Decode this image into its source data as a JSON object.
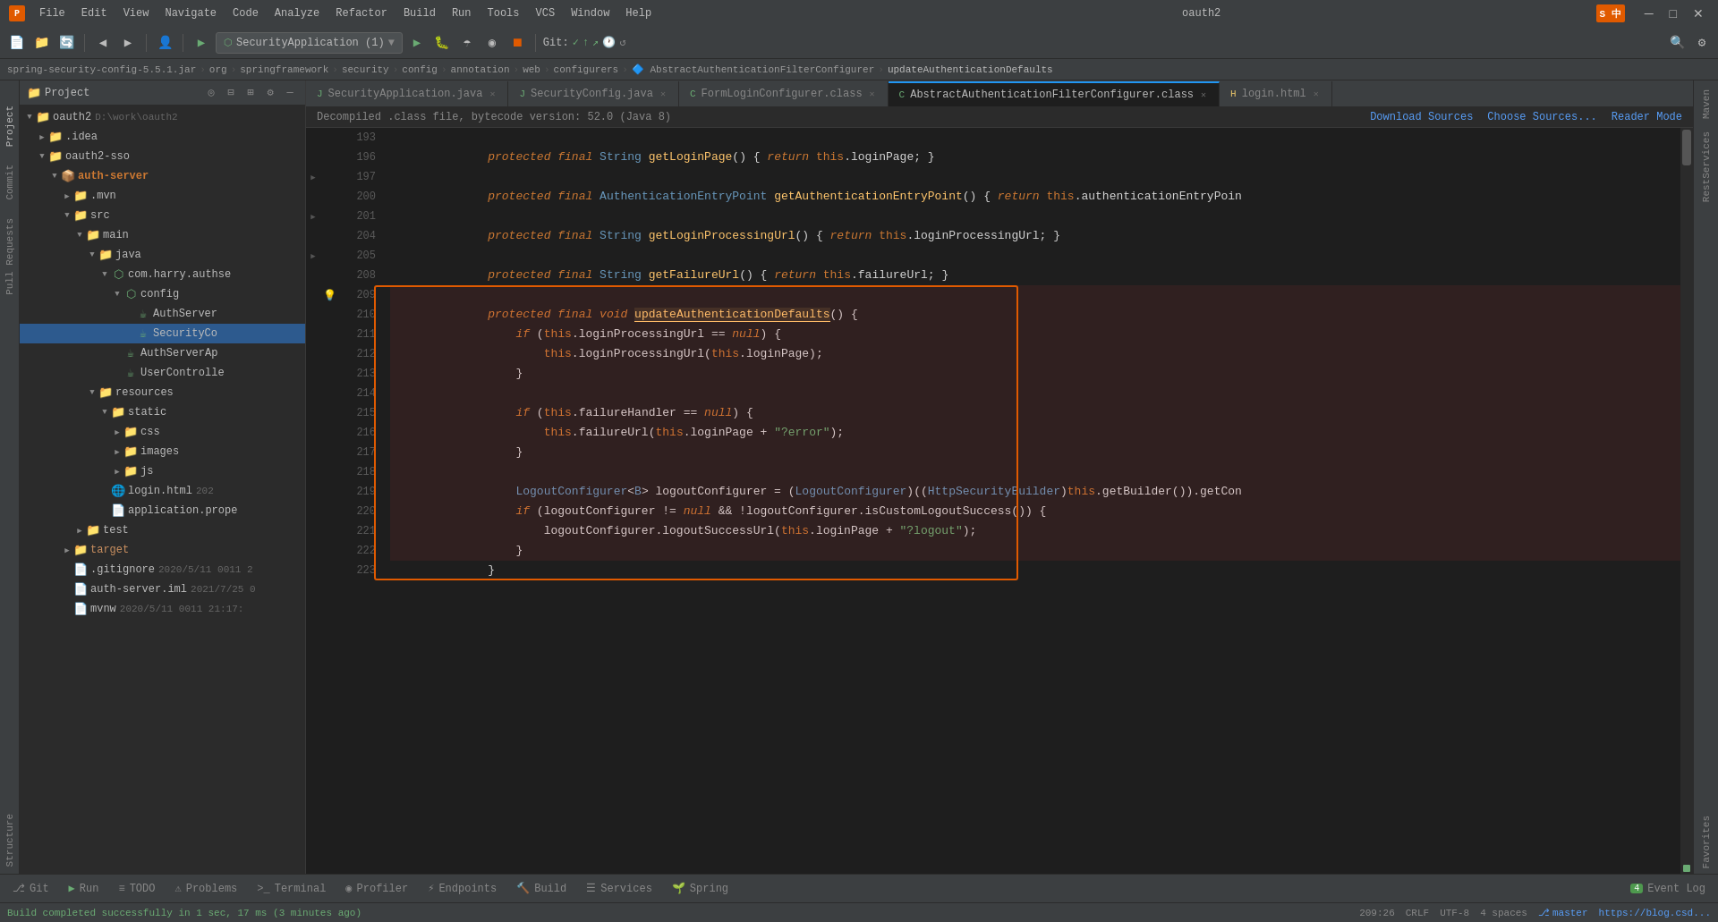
{
  "app": {
    "title": "oauth2"
  },
  "titlebar": {
    "menus": [
      "File",
      "Edit",
      "View",
      "Navigate",
      "Code",
      "Analyze",
      "Refactor",
      "Build",
      "Run",
      "Tools",
      "VCS",
      "Window",
      "Help"
    ],
    "logo": "P"
  },
  "toolbar": {
    "combo_label": "SecurityApplication (1)",
    "git_label": "Git:",
    "run_icon": "▶",
    "build_icon": "🔨"
  },
  "breadcrumb": {
    "items": [
      "spring-security-config-5.5.1.jar",
      "org",
      "springframework",
      "security",
      "config",
      "annotation",
      "web",
      "configurers",
      "AbstractAuthenticationFilterConfigurer",
      "updateAuthenticationDefaults"
    ]
  },
  "tabs": [
    {
      "label": "SecurityApplication.java",
      "type": "java",
      "active": false
    },
    {
      "label": "SecurityConfig.java",
      "type": "java",
      "active": false
    },
    {
      "label": "FormLoginConfigurer.class",
      "type": "class",
      "active": false
    },
    {
      "label": "AbstractAuthenticationFilterConfigurer.class",
      "type": "class",
      "active": true
    },
    {
      "label": "login.html",
      "type": "html",
      "active": false
    }
  ],
  "decompiled_bar": {
    "notice": "Decompiled .class file, bytecode version: 52.0 (Java 8)",
    "download_sources": "Download Sources",
    "choose_sources": "Choose Sources...",
    "reader_mode": "Reader Mode"
  },
  "code": {
    "lines": [
      {
        "num": 193,
        "content": "    <kw>protected</kw> <kw>final</kw> <type>String</type> <fn>getLoginPage</fn>() { <kw>return</kw> <kw2>this</kw2>.loginPage; }"
      },
      {
        "num": 196,
        "content": ""
      },
      {
        "num": 197,
        "content": "    <kw>protected</kw> <kw>final</kw> <type>AuthenticationEntryPoint</type> <fn>getAuthenticationEntryPoint</fn>() { <kw>return</kw> <kw2>this</kw2>.authenticationEntryPoin"
      },
      {
        "num": 200,
        "content": ""
      },
      {
        "num": 201,
        "content": "    <kw>protected</kw> <kw>final</kw> <type>String</type> <fn>getLoginProcessingUrl</fn>() { <kw>return</kw> <kw2>this</kw2>.loginProcessingUrl; }"
      },
      {
        "num": 204,
        "content": ""
      },
      {
        "num": 205,
        "content": "    <kw>protected</kw> <kw>final</kw> <type>String</type> <fn>getFailureUrl</fn>() { <kw>return</kw> <kw2>this</kw2>.failureUrl; }"
      },
      {
        "num": 208,
        "content": ""
      },
      {
        "num": 209,
        "content": "    <kw>protected</kw> <kw>final</kw> <kw>void</kw> <highlight-method>updateAuthenticationDefaults</highlight-method>() {",
        "highlighted": true,
        "has_bulb": true
      },
      {
        "num": 210,
        "content": "        <kw>if</kw> (<kw2>this</kw2>.loginProcessingUrl == <kw>null</kw>) {",
        "highlighted": true
      },
      {
        "num": 211,
        "content": "            <kw2>this</kw2>.loginProcessingUrl(<kw2>this</kw2>.loginPage);",
        "highlighted": true
      },
      {
        "num": 212,
        "content": "        }",
        "highlighted": true
      },
      {
        "num": 213,
        "content": "",
        "highlighted": true
      },
      {
        "num": 214,
        "content": "        <kw>if</kw> (<kw2>this</kw2>.failureHandler == <kw>null</kw>) {",
        "highlighted": true
      },
      {
        "num": 215,
        "content": "            <kw2>this</kw2>.failureUrl(<kw2>this</kw2>.loginPage + <str>\"?error\"</str>);",
        "highlighted": true
      },
      {
        "num": 216,
        "content": "        }",
        "highlighted": true
      },
      {
        "num": 217,
        "content": "",
        "highlighted": true
      },
      {
        "num": 218,
        "content": "        <type>LogoutConfigurer</type>&lt;<type>B</type>&gt; logoutConfigurer = (<type>LogoutConfigurer</type>)((<type>HttpSecurityBuilder</type>)<kw2>this</kw2>.getBuilder()).getCon",
        "highlighted": true
      },
      {
        "num": 219,
        "content": "        <kw>if</kw> (logoutConfigurer != <kw>null</kw> &amp;&amp; !logoutConfigurer.isCustomLogoutSuccess()) {",
        "highlighted": true
      },
      {
        "num": 220,
        "content": "            logoutConfigurer.logoutSuccessUrl(<kw2>this</kw2>.loginPage + <str>\"?logout\"</str>);",
        "highlighted": true
      },
      {
        "num": 221,
        "content": "        }",
        "highlighted": true
      },
      {
        "num": 222,
        "content": "    }",
        "highlighted": true
      },
      {
        "num": 223,
        "content": ""
      }
    ]
  },
  "project_tree": {
    "root": "oauth2",
    "root_path": "D:\\work\\oauth2",
    "items": [
      {
        "label": ".idea",
        "type": "folder",
        "level": 1,
        "expanded": false
      },
      {
        "label": "oauth2-sso",
        "type": "folder",
        "level": 1,
        "expanded": true
      },
      {
        "label": "auth-server",
        "type": "folder-module",
        "level": 2,
        "expanded": true
      },
      {
        "label": ".mvn",
        "type": "folder",
        "level": 3,
        "expanded": false
      },
      {
        "label": "src",
        "type": "folder",
        "level": 3,
        "expanded": true
      },
      {
        "label": "main",
        "type": "folder",
        "level": 4,
        "expanded": true
      },
      {
        "label": "java",
        "type": "folder",
        "level": 5,
        "expanded": true
      },
      {
        "label": "com.harry.authse",
        "type": "package",
        "level": 6,
        "expanded": true
      },
      {
        "label": "config",
        "type": "package",
        "level": 7,
        "expanded": true
      },
      {
        "label": "AuthServer",
        "type": "java",
        "level": 8,
        "expanded": false
      },
      {
        "label": "SecurityCo",
        "type": "java",
        "level": 8,
        "expanded": false,
        "selected": true
      },
      {
        "label": "AuthServerAp",
        "type": "java",
        "level": 7,
        "expanded": false
      },
      {
        "label": "UserControlle",
        "type": "java",
        "level": 7,
        "expanded": false
      },
      {
        "label": "resources",
        "type": "folder",
        "level": 5,
        "expanded": true
      },
      {
        "label": "static",
        "type": "folder",
        "level": 6,
        "expanded": true
      },
      {
        "label": "css",
        "type": "folder",
        "level": 7,
        "expanded": false
      },
      {
        "label": "images",
        "type": "folder",
        "level": 7,
        "expanded": false
      },
      {
        "label": "js",
        "type": "folder",
        "level": 7,
        "expanded": false
      },
      {
        "label": "login.html",
        "type": "html",
        "level": 6,
        "meta": "202",
        "expanded": false
      },
      {
        "label": "application.prope",
        "type": "properties",
        "level": 6,
        "expanded": false
      },
      {
        "label": "test",
        "type": "folder",
        "level": 4,
        "expanded": false
      },
      {
        "label": "target",
        "type": "folder",
        "level": 3,
        "expanded": false,
        "highlight": true
      },
      {
        "label": ".gitignore",
        "type": "file",
        "level": 3,
        "meta": "2020/5/11 0011 2",
        "expanded": false
      },
      {
        "label": "auth-server.iml",
        "type": "iml",
        "level": 3,
        "meta": "2021/7/25 0",
        "expanded": false
      },
      {
        "label": "mvnw",
        "type": "file",
        "level": 3,
        "meta": "2020/5/11 0011 21:17:",
        "expanded": false
      }
    ]
  },
  "sidebar_labels": {
    "left": [
      "Project",
      "Commit",
      "Pull Requests",
      "Structure"
    ],
    "right": [
      "Maven",
      "RestServices",
      "Favorites"
    ]
  },
  "status_bar": {
    "message": "Build completed successfully in 1 sec, 17 ms (3 minutes ago)",
    "position": "209:26",
    "encoding": "CRLF",
    "charset": "UTF",
    "line_sep": "CRLF",
    "branch": "master",
    "event_log": "Event Log",
    "event_count": "4"
  },
  "bottom_toolbar": {
    "buttons": [
      {
        "label": "Git",
        "icon": "⎇"
      },
      {
        "label": "Run",
        "icon": "▶"
      },
      {
        "label": "TODO",
        "icon": "≡"
      },
      {
        "label": "Problems",
        "icon": "⚠"
      },
      {
        "label": "Terminal",
        "icon": ">"
      },
      {
        "label": "Profiler",
        "icon": "◉"
      },
      {
        "label": "Endpoints",
        "icon": "⚡"
      },
      {
        "label": "Build",
        "icon": "🔨"
      },
      {
        "label": "Services",
        "icon": "☰"
      },
      {
        "label": "Spring",
        "icon": "🌱"
      }
    ]
  }
}
